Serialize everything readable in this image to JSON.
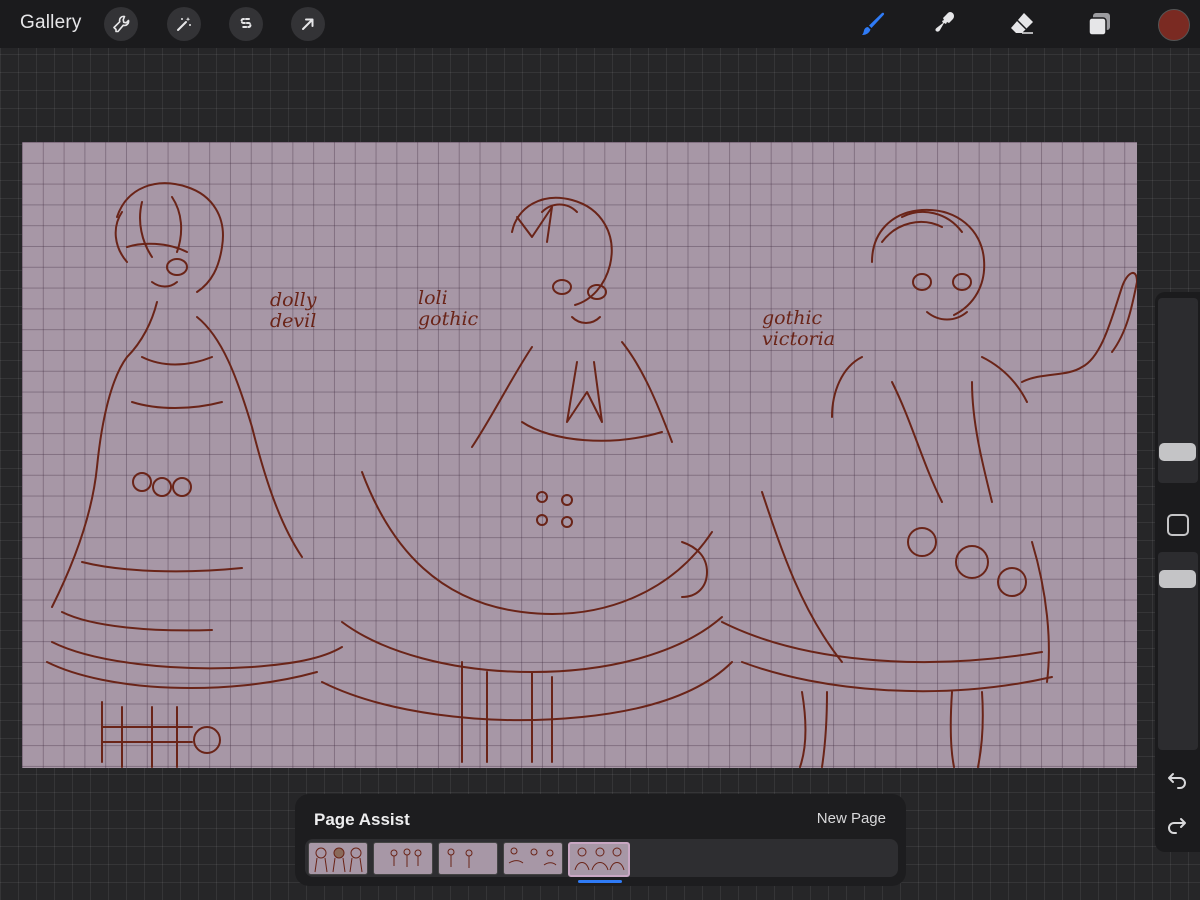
{
  "app": {
    "gallery_label": "Gallery",
    "left_tools": [
      "wrench-icon",
      "magic-wand-icon",
      "selection-icon",
      "transform-arrow-icon"
    ],
    "right_tools": [
      "brush-icon",
      "smudge-icon",
      "eraser-icon",
      "layers-icon"
    ],
    "active_tool": "brush-icon",
    "accent_color": "#2f7bf6",
    "current_color": "#7a2a22"
  },
  "canvas": {
    "background_color": "#a797a6",
    "ink_color": "#6a2418",
    "captions": [
      {
        "text": "dolly\ndevil"
      },
      {
        "text": "loli\ngothic"
      },
      {
        "text": "gothic\nvictoria"
      }
    ]
  },
  "sidebar": {
    "brush_size_icon": "size-slider",
    "modify_icon": "modify-square-icon",
    "opacity_icon": "opacity-slider",
    "undo_icon": "undo-icon",
    "redo_icon": "redo-icon"
  },
  "page_assist": {
    "title": "Page Assist",
    "new_page_label": "New Page",
    "page_count": 5,
    "active_page": 5
  }
}
